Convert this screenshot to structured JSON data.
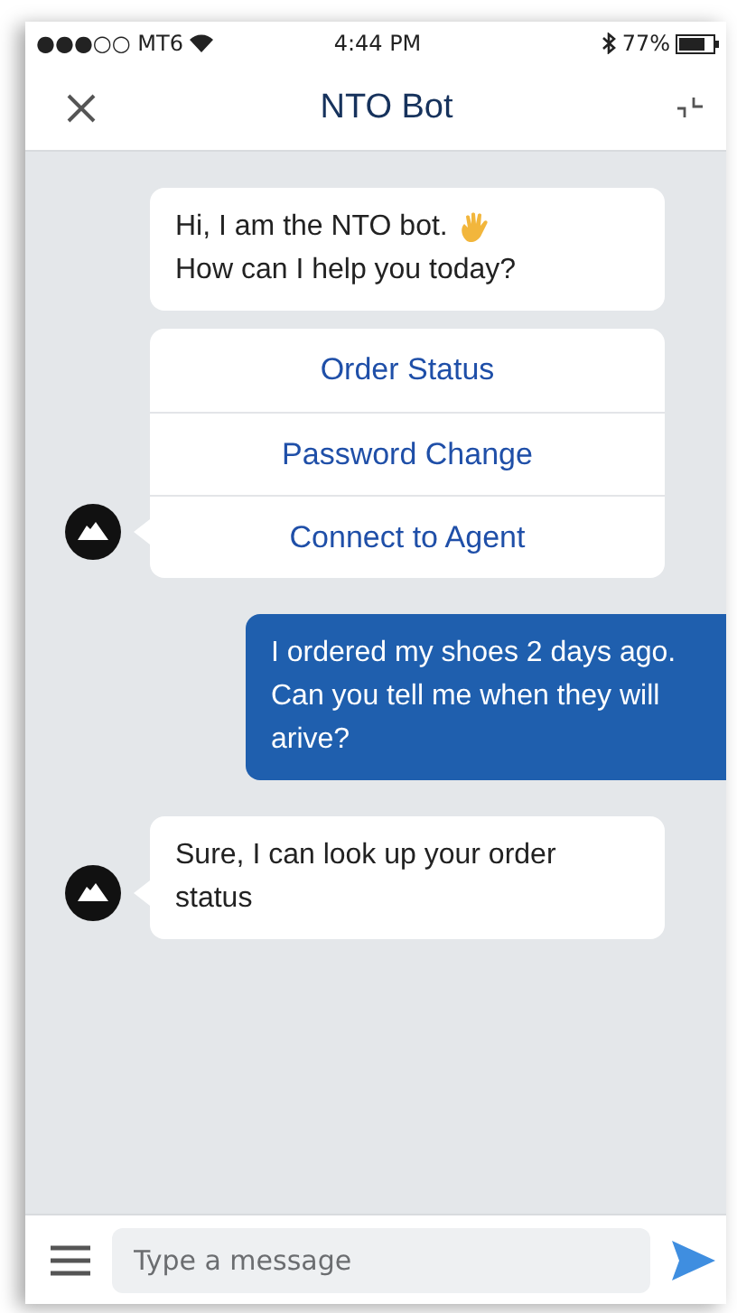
{
  "status_bar": {
    "carrier": "●●●○○ MT6",
    "time": "4:44 PM",
    "battery": "77%"
  },
  "header": {
    "title": "NTO Bot"
  },
  "messages": [
    {
      "kind": "bot_text",
      "text_before": "Hi, I am the NTO bot.",
      "text_after": "How can I help you today?",
      "avatar": false
    },
    {
      "kind": "bot_options",
      "options": [
        "Order Status",
        "Password Change",
        "Connect to Agent"
      ],
      "avatar": true
    },
    {
      "kind": "user_text",
      "text": "I ordered my shoes 2 days ago. Can you tell me when they will arive?"
    },
    {
      "kind": "bot_text",
      "text_before": "Sure, I can look up your order status",
      "avatar": true
    }
  ],
  "composer": {
    "placeholder": "Type a message"
  }
}
